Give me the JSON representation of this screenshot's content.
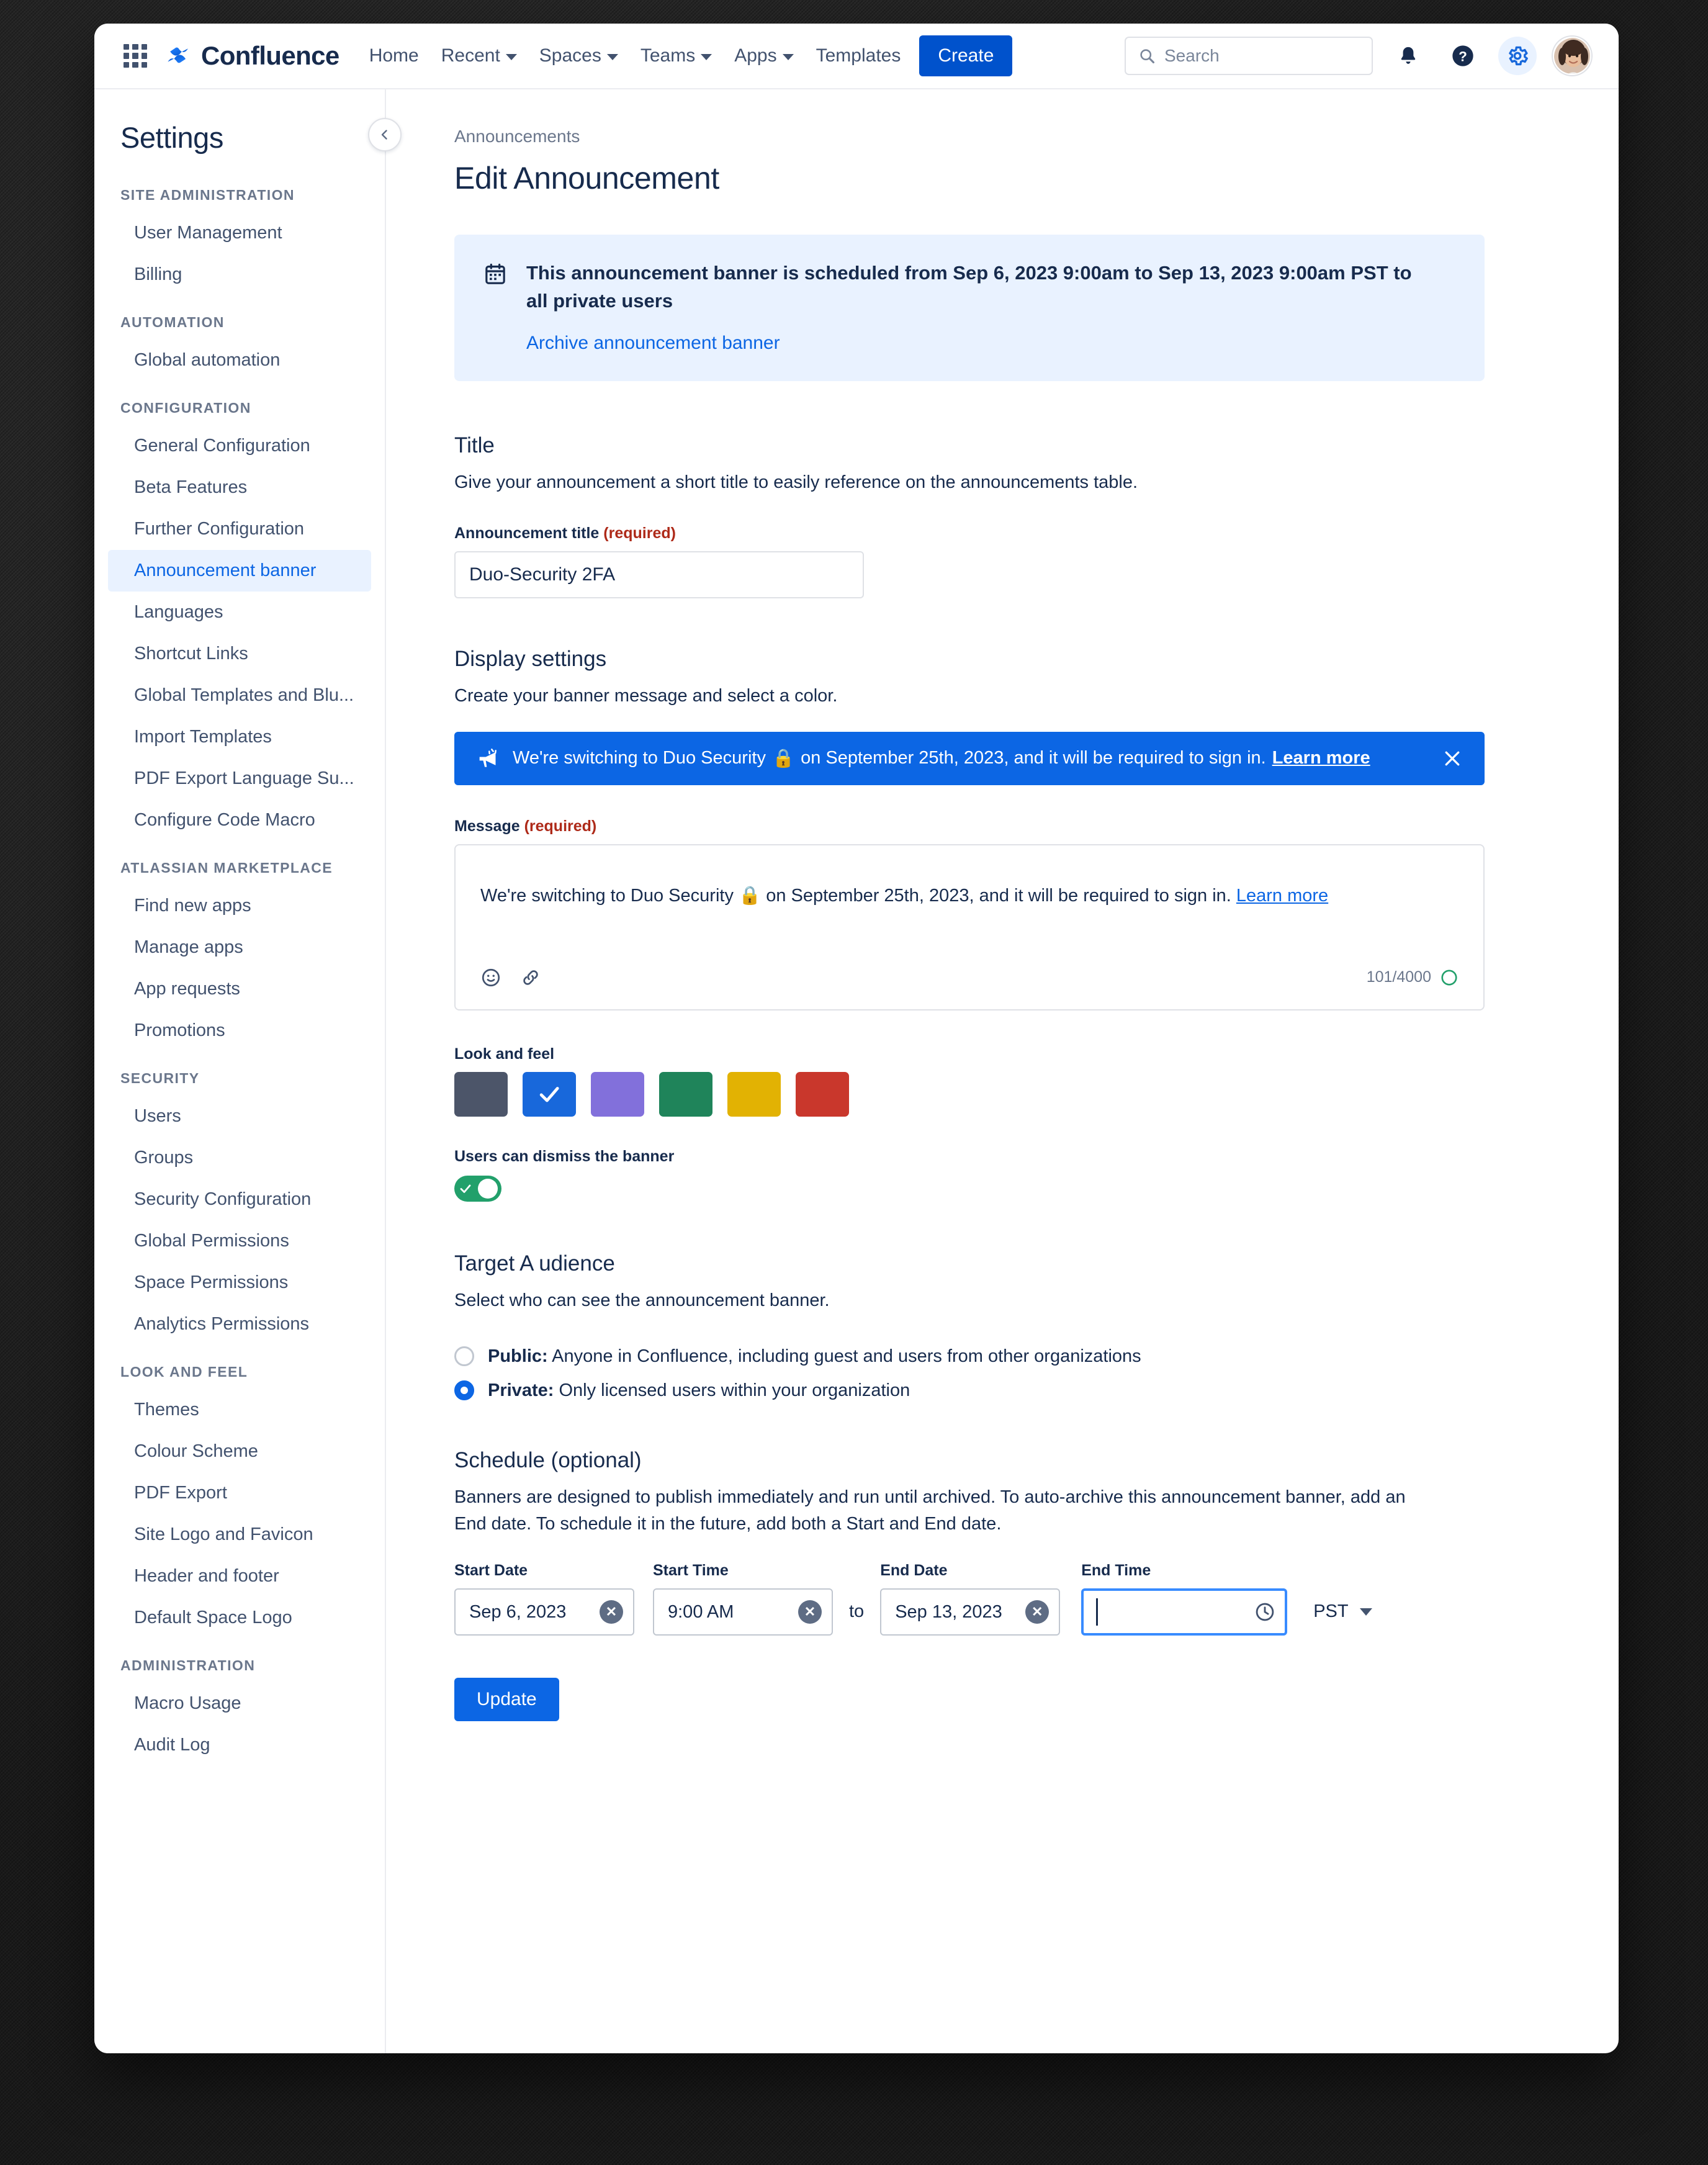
{
  "topnav": {
    "app_switcher": "app-switcher",
    "brand": "Confluence",
    "items": [
      {
        "label": "Home",
        "has_caret": false
      },
      {
        "label": "Recent",
        "has_caret": true
      },
      {
        "label": "Spaces",
        "has_caret": true
      },
      {
        "label": "Teams",
        "has_caret": true
      },
      {
        "label": "Apps",
        "has_caret": true
      },
      {
        "label": "Templates",
        "has_caret": false
      }
    ],
    "create_label": "Create",
    "search_placeholder": "Search",
    "icons": [
      "notification-bell-icon",
      "help-icon",
      "settings-gear-icon",
      "avatar"
    ]
  },
  "sidebar": {
    "title": "Settings",
    "groups": [
      {
        "label": "SITE ADMINISTRATION",
        "items": [
          "User Management",
          "Billing"
        ]
      },
      {
        "label": "AUTOMATION",
        "items": [
          "Global automation"
        ]
      },
      {
        "label": "CONFIGURATION",
        "items": [
          "General Configuration",
          "Beta Features",
          "Further Configuration",
          "Announcement banner",
          "Languages",
          "Shortcut Links",
          "Global Templates and Blu...",
          "Import Templates",
          "PDF Export Language Su...",
          "Configure Code Macro"
        ]
      },
      {
        "label": "ATLASSIAN MARKETPLACE",
        "items": [
          "Find new apps",
          "Manage apps",
          "App requests",
          "Promotions"
        ]
      },
      {
        "label": "SECURITY",
        "items": [
          "Users",
          "Groups",
          "Security Configuration",
          "Global Permissions",
          "Space Permissions",
          "Analytics Permissions"
        ]
      },
      {
        "label": "LOOK AND FEEL",
        "items": [
          "Themes",
          "Colour Scheme",
          "PDF Export",
          "Site Logo and Favicon",
          "Header and footer",
          "Default Space Logo"
        ]
      },
      {
        "label": "ADMINISTRATION",
        "items": [
          "Macro Usage",
          "Audit Log"
        ]
      }
    ],
    "selected_item": "Announcement banner"
  },
  "main": {
    "breadcrumb": "Announcements",
    "page_title": "Edit Announcement",
    "info_banner": {
      "text": "This announcement banner is scheduled from Sep 6, 2023 9:00am to Sep 13, 2023 9:00am PST to all private users",
      "link": "Archive announcement banner"
    },
    "title_section": {
      "heading": "Title",
      "description": "Give your announcement a short title to easily reference on the announcements table.",
      "field_label": "Announcement title",
      "required_tag": "(required)",
      "value": "Duo-Security 2FA"
    },
    "display_section": {
      "heading": "Display settings",
      "description": "Create your banner message and select a color.",
      "preview": {
        "text_before": "We're switching to Duo Security",
        "emoji": "🔒",
        "text_after": "on September 25th, 2023, and it will be required to sign in.",
        "link": "Learn more",
        "background": "#0c66e4"
      },
      "message_label": "Message",
      "message_required": "(required)",
      "message_text_before": "We're switching to Duo Security",
      "message_emoji": "🔒",
      "message_text_after": "on September 25th, 2023, and it will be required to sign in.",
      "message_link": "Learn more",
      "char_count": "101/4000",
      "look_and_feel_label": "Look and feel",
      "colors": [
        {
          "name": "slate",
          "hex": "#4c5569",
          "selected": false
        },
        {
          "name": "blue",
          "hex": "#1868db",
          "selected": true
        },
        {
          "name": "purple",
          "hex": "#8270db",
          "selected": false
        },
        {
          "name": "green",
          "hex": "#1f845a",
          "selected": false
        },
        {
          "name": "yellow",
          "hex": "#e2b203",
          "selected": false
        },
        {
          "name": "red",
          "hex": "#c9372c",
          "selected": false
        }
      ],
      "dismiss_label": "Users can dismiss the banner",
      "dismiss_enabled": true
    },
    "audience_section": {
      "heading": "Target A udience",
      "description": "Select who can see the announcement banner.",
      "options": [
        {
          "bold": "Public:",
          "rest": "Anyone in Confluence, including guest and users from other organizations",
          "selected": false
        },
        {
          "bold": "Private:",
          "rest": "Only licensed users within your organization",
          "selected": true
        }
      ]
    },
    "schedule_section": {
      "heading": "Schedule (optional)",
      "description": "Banners are designed to publish immediately and run until archived. To auto-archive this announcement banner, add an End date. To schedule it in the future, add both a Start and End date.",
      "start_date_label": "Start Date",
      "start_date_value": "Sep 6, 2023",
      "start_time_label": "Start Time",
      "start_time_value": "9:00 AM",
      "to_label": "to",
      "end_date_label": "End Date",
      "end_date_value": "Sep 13, 2023",
      "end_time_label": "End Time",
      "end_time_value": "",
      "timezone": "PST"
    },
    "update_label": "Update"
  }
}
